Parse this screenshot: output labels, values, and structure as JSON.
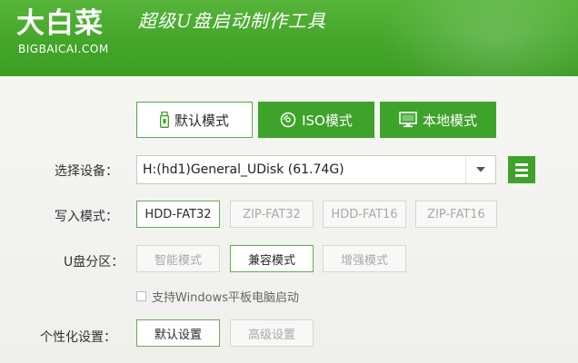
{
  "brand": {
    "name": "大白菜",
    "domain": "BIGBAICAI.COM",
    "slogan": "超级U盘启动制作工具"
  },
  "mode_tabs": [
    {
      "label": "默认模式",
      "icon": "usb-drive-icon",
      "selected": true
    },
    {
      "label": "ISO模式",
      "icon": "disc-icon",
      "selected": false
    },
    {
      "label": "本地模式",
      "icon": "monitor-icon",
      "selected": false
    }
  ],
  "device": {
    "label": "选择设备：",
    "value": "H:(hd1)General_UDisk (61.74G)"
  },
  "write_mode": {
    "label": "写入模式：",
    "options": [
      "HDD-FAT32",
      "ZIP-FAT32",
      "HDD-FAT16",
      "ZIP-FAT16"
    ],
    "selected": "HDD-FAT32"
  },
  "partition": {
    "label": "U盘分区：",
    "options": [
      "智能模式",
      "兼容模式",
      "增强模式"
    ],
    "selected": "兼容模式"
  },
  "tablet_boot": {
    "label": "支持Windows平板电脑启动",
    "checked": false
  },
  "personalize": {
    "label": "个性化设置：",
    "options": [
      "默认设置",
      "高级设置"
    ],
    "selected": "默认设置"
  },
  "colors": {
    "brand_green": "#3ea32a",
    "header_green": "#4aab31",
    "selected_border": "#6aa95a"
  }
}
